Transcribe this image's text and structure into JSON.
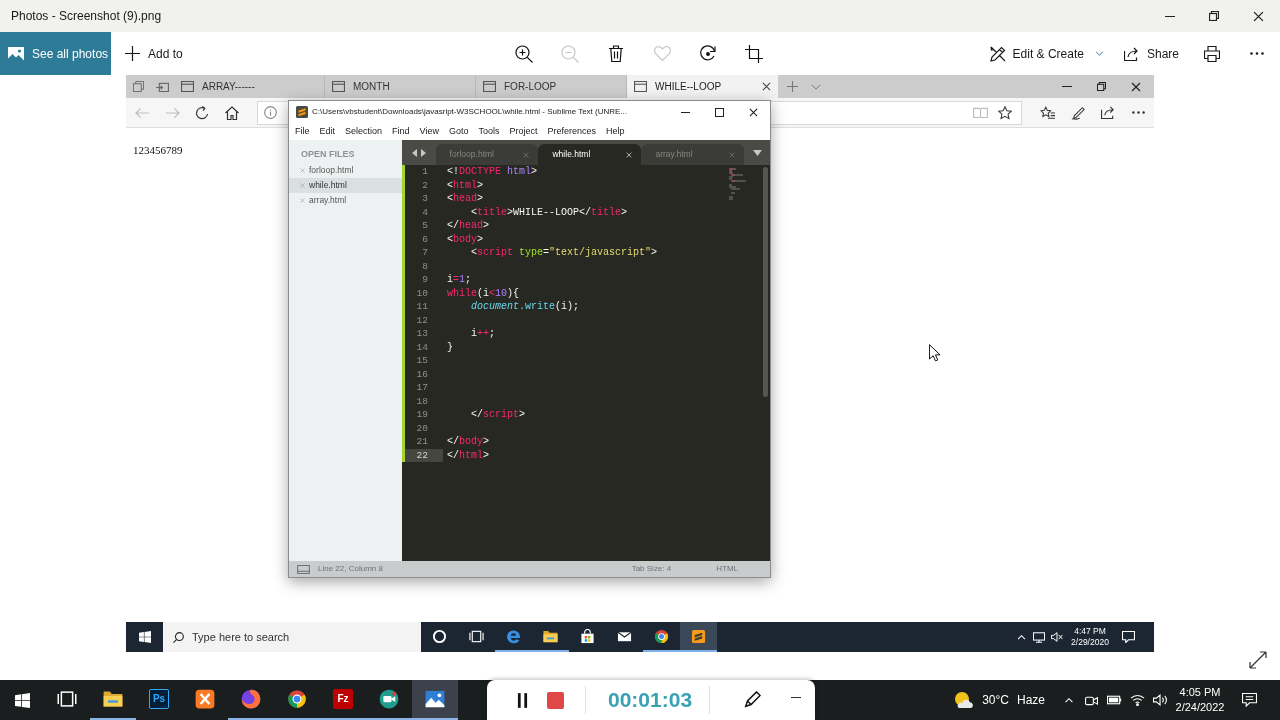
{
  "photos": {
    "title": "Photos - Screenshot (9).png",
    "see_all": "See all photos",
    "add_to": "Add to",
    "tools": [
      {
        "kind": "zoom-in",
        "disabled": false
      },
      {
        "kind": "zoom-out",
        "disabled": true
      },
      {
        "kind": "delete",
        "disabled": false
      },
      {
        "kind": "favorite",
        "disabled": true
      },
      {
        "kind": "rotate",
        "disabled": false
      },
      {
        "kind": "crop",
        "disabled": false
      }
    ],
    "edit_create": "Edit & Create",
    "share": "Share"
  },
  "browser": {
    "tabs": [
      {
        "label": "ARRAY------",
        "selected": false
      },
      {
        "label": "MONTH",
        "selected": false
      },
      {
        "label": "FOR-LOOP",
        "selected": false
      },
      {
        "label": "WHILE--LOOP",
        "selected": true
      }
    ],
    "nav": [
      {
        "kind": "back",
        "disabled": true
      },
      {
        "kind": "forward",
        "disabled": true
      },
      {
        "kind": "refresh",
        "disabled": false
      },
      {
        "kind": "home",
        "disabled": false
      }
    ],
    "page_text": "123456789"
  },
  "editor": {
    "title": "C:\\Users\\vbstudent\\Downloads\\javasript-W3SCHOOL\\while.html - Sublime Text (UNRE...",
    "menu": [
      "File",
      "Edit",
      "Selection",
      "Find",
      "View",
      "Goto",
      "Tools",
      "Project",
      "Preferences",
      "Help"
    ],
    "sidebar": {
      "heading": "OPEN FILES",
      "files": [
        {
          "name": "forloop.html",
          "selected": false
        },
        {
          "name": "while.html",
          "selected": true
        },
        {
          "name": "array.html",
          "selected": false
        }
      ]
    },
    "tabs": [
      {
        "label": "forloop.html",
        "selected": false
      },
      {
        "label": "while.html",
        "selected": true
      },
      {
        "label": "array.html",
        "selected": false
      }
    ],
    "lines": [
      {
        "number": "1",
        "current": false,
        "tokens": [
          {
            "text": "<!",
            "kind": "text"
          },
          {
            "text": "DOCTYPE",
            "kind": "keyword"
          },
          {
            "text": " html",
            "kind": "const"
          },
          {
            "text": ">",
            "kind": "text"
          }
        ]
      },
      {
        "number": "2",
        "current": false,
        "tokens": [
          {
            "text": "<",
            "kind": "text"
          },
          {
            "text": "html",
            "kind": "keyword"
          },
          {
            "text": ">",
            "kind": "text"
          }
        ]
      },
      {
        "number": "3",
        "current": false,
        "tokens": [
          {
            "text": "<",
            "kind": "text"
          },
          {
            "text": "head",
            "kind": "keyword"
          },
          {
            "text": ">",
            "kind": "text"
          }
        ]
      },
      {
        "number": "4",
        "current": false,
        "tokens": [
          {
            "text": "    <",
            "kind": "text"
          },
          {
            "text": "title",
            "kind": "keyword"
          },
          {
            "text": ">WHILE--LOOP</",
            "kind": "text"
          },
          {
            "text": "title",
            "kind": "keyword"
          },
          {
            "text": ">",
            "kind": "text"
          }
        ]
      },
      {
        "number": "5",
        "current": false,
        "tokens": [
          {
            "text": "</",
            "kind": "text"
          },
          {
            "text": "head",
            "kind": "keyword"
          },
          {
            "text": ">",
            "kind": "text"
          }
        ]
      },
      {
        "number": "6",
        "current": false,
        "tokens": [
          {
            "text": "<",
            "kind": "text"
          },
          {
            "text": "body",
            "kind": "keyword"
          },
          {
            "text": ">",
            "kind": "text"
          }
        ]
      },
      {
        "number": "7",
        "current": false,
        "tokens": [
          {
            "text": "    <",
            "kind": "text"
          },
          {
            "text": "script",
            "kind": "keyword"
          },
          {
            "text": " type",
            "kind": "attr"
          },
          {
            "text": "=",
            "kind": "text"
          },
          {
            "text": "\"text/javascript\"",
            "kind": "string"
          },
          {
            "text": ">",
            "kind": "text"
          }
        ]
      },
      {
        "number": "8",
        "current": false
      },
      {
        "number": "9",
        "current": false,
        "tokens": [
          {
            "text": "i",
            "kind": "text"
          },
          {
            "text": "=",
            "kind": "keyword"
          },
          {
            "text": "1",
            "kind": "const"
          },
          {
            "text": ";",
            "kind": "text"
          }
        ]
      },
      {
        "number": "10",
        "current": false,
        "tokens": [
          {
            "text": "while",
            "kind": "keyword"
          },
          {
            "text": "(i",
            "kind": "text"
          },
          {
            "text": "<",
            "kind": "keyword"
          },
          {
            "text": "10",
            "kind": "const"
          },
          {
            "text": "){",
            "kind": "text"
          }
        ]
      },
      {
        "number": "11",
        "current": false,
        "tokens": [
          {
            "text": "    document",
            "kind": "support"
          },
          {
            "text": ".write",
            "kind": "func"
          },
          {
            "text": "(i);",
            "kind": "text"
          }
        ]
      },
      {
        "number": "12",
        "current": false
      },
      {
        "number": "13",
        "current": false,
        "tokens": [
          {
            "text": "    i",
            "kind": "text"
          },
          {
            "text": "++",
            "kind": "keyword"
          },
          {
            "text": ";",
            "kind": "text"
          }
        ]
      },
      {
        "number": "14",
        "current": false,
        "tokens": [
          {
            "text": "}",
            "kind": "text"
          }
        ]
      },
      {
        "number": "15",
        "current": false
      },
      {
        "number": "16",
        "current": false
      },
      {
        "number": "17",
        "current": false
      },
      {
        "number": "18",
        "current": false
      },
      {
        "number": "19",
        "current": false,
        "tokens": [
          {
            "text": "    </",
            "kind": "text"
          },
          {
            "text": "script",
            "kind": "keyword"
          },
          {
            "text": ">",
            "kind": "text"
          }
        ]
      },
      {
        "number": "20",
        "current": false
      },
      {
        "number": "21",
        "current": false,
        "tokens": [
          {
            "text": "</",
            "kind": "text"
          },
          {
            "text": "body",
            "kind": "keyword"
          },
          {
            "text": ">",
            "kind": "text"
          }
        ]
      },
      {
        "number": "22",
        "current": true,
        "tokens": [
          {
            "text": "</",
            "kind": "text"
          },
          {
            "text": "html",
            "kind": "keyword"
          },
          {
            "text": ">",
            "kind": "text"
          }
        ]
      }
    ],
    "status": {
      "position": "Line 22, Column 8",
      "tab_size": "Tab Size: 4",
      "syntax": "HTML"
    }
  },
  "desktop_taskbar": {
    "search": {
      "placeholder": "Type here to search"
    },
    "apps": [
      {
        "kind": "cortana",
        "selected": false,
        "running": false
      },
      {
        "kind": "task-view",
        "selected": false,
        "running": false
      },
      {
        "kind": "edge",
        "selected": false,
        "running": true
      },
      {
        "kind": "explorer",
        "selected": false,
        "running": true
      },
      {
        "kind": "store",
        "selected": false,
        "running": false
      },
      {
        "kind": "mail",
        "selected": false,
        "running": false
      },
      {
        "kind": "chrome",
        "selected": false,
        "running": true
      },
      {
        "kind": "sublime",
        "selected": true,
        "running": true
      }
    ],
    "time": "4:47 PM",
    "date": "2/29/2020"
  },
  "taskbar": {
    "apps": [
      {
        "kind": "task-view",
        "selected": false,
        "running": false
      },
      {
        "kind": "explorer",
        "selected": false,
        "running": true
      },
      {
        "kind": "photoshop",
        "label": "Ps",
        "selected": false,
        "running": false
      },
      {
        "kind": "xampp",
        "selected": false,
        "running": false
      },
      {
        "kind": "firefox",
        "selected": false,
        "running": true
      },
      {
        "kind": "chrome",
        "selected": false,
        "running": true
      },
      {
        "kind": "filezilla",
        "label": "Fz",
        "selected": false,
        "running": true
      },
      {
        "kind": "camera",
        "selected": false,
        "running": true
      },
      {
        "kind": "photos",
        "selected": true,
        "running": true
      }
    ],
    "recorder": {
      "timer": "00:01:03"
    },
    "weather": {
      "temperature": "30°C",
      "condition": "Haze"
    },
    "time": "4:05 PM",
    "date": "2/24/2022"
  }
}
